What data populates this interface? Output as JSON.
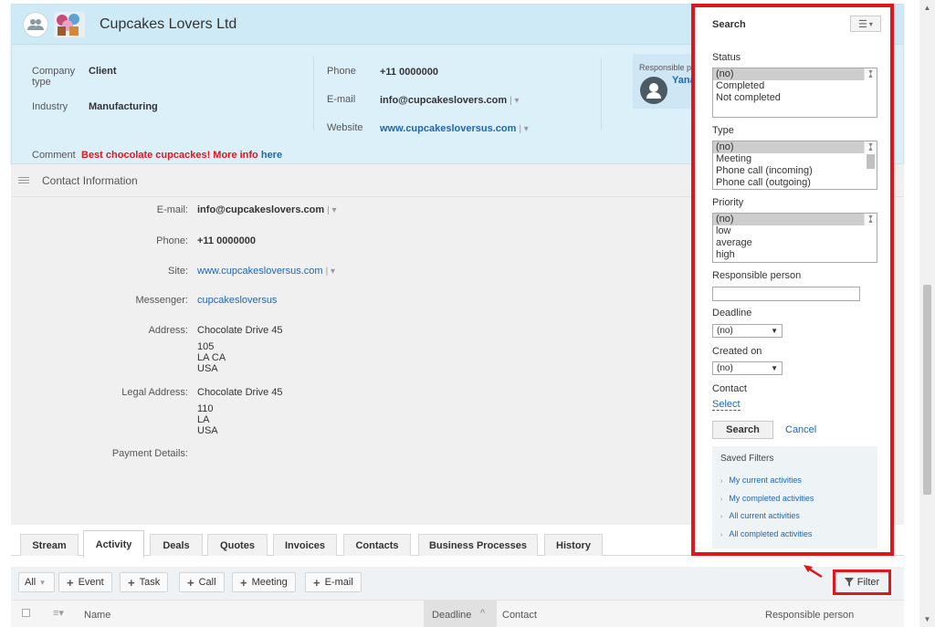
{
  "header": {
    "company_name": "Cupcakes Lovers Ltd",
    "company_type_label": "Company type",
    "company_type_value": "Client",
    "industry_label": "Industry",
    "industry_value": "Manufacturing",
    "phone_label": "Phone",
    "phone_value": "+11 0000000",
    "email_label": "E-mail",
    "email_value": "info@cupcakeslovers.com",
    "website_label": "Website",
    "website_value": "www.cupcakesloversus.com",
    "responsible_label": "Responsible p",
    "responsible_name": "Yana",
    "comment_label": "Comment",
    "comment_text": "Best chocolate cupcackes! More info",
    "comment_link": "here"
  },
  "contact": {
    "section_title": "Contact Information",
    "rows": [
      {
        "label": "E-mail:",
        "value": "info@cupcakeslovers.com"
      },
      {
        "label": "Phone:",
        "value": "+11 0000000"
      },
      {
        "label": "Site:",
        "value": "www.cupcakesloversus.com"
      },
      {
        "label": "Messenger:",
        "value": "cupcakesloversus"
      },
      {
        "label": "Address:",
        "lines": [
          "Chocolate Drive 45",
          "105",
          "LA CA",
          "USA"
        ]
      },
      {
        "label": "Legal Address:",
        "lines": [
          "Chocolate Drive 45",
          "110",
          "LA",
          "USA"
        ]
      },
      {
        "label": "Payment Details:",
        "value": ""
      }
    ]
  },
  "tabs": [
    "Stream",
    "Activity",
    "Deals",
    "Quotes",
    "Invoices",
    "Contacts",
    "Business Processes",
    "History"
  ],
  "toolbar": {
    "all_label": "All",
    "buttons": [
      "Event",
      "Task",
      "Call",
      "Meeting",
      "E-mail"
    ],
    "filter_label": "Filter"
  },
  "grid": {
    "columns": [
      "Name",
      "Deadline",
      "Contact",
      "Responsible person"
    ]
  },
  "search_panel": {
    "title": "Search",
    "status_label": "Status",
    "status_options": [
      "(no)",
      "Completed",
      "Not completed"
    ],
    "type_label": "Type",
    "type_options": [
      "(no)",
      "Meeting",
      "Phone call (incoming)",
      "Phone call (outgoing)"
    ],
    "priority_label": "Priority",
    "priority_options": [
      "(no)",
      "low",
      "average",
      "high"
    ],
    "responsible_label": "Responsible person",
    "responsible_value": "",
    "deadline_label": "Deadline",
    "deadline_value": "(no)",
    "created_label": "Created on",
    "created_value": "(no)",
    "contact_label": "Contact",
    "contact_select": "Select",
    "search_button": "Search",
    "cancel_link": "Cancel",
    "saved_filters_title": "Saved Filters",
    "saved_filters": [
      "My current activities",
      "My completed activities",
      "All current activities",
      "All completed activities"
    ]
  },
  "colors": {
    "highlight_red": "#e0161d",
    "link_blue": "#2067b0",
    "header_bg": "#dcf0fa",
    "comment_red": "#e0161d"
  }
}
